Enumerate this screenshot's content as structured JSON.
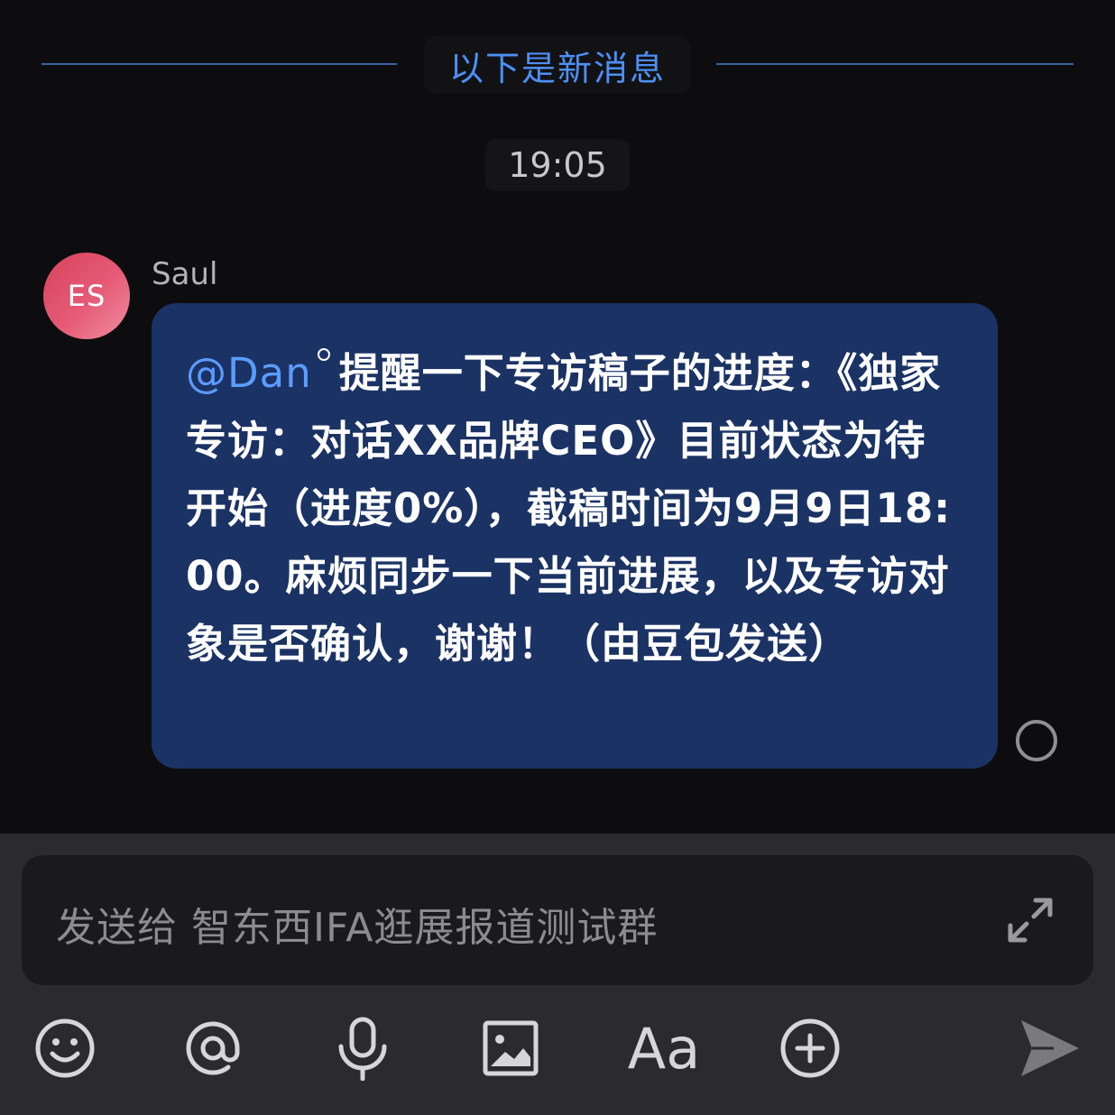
{
  "divider": {
    "label": "以下是新消息"
  },
  "timestamp": "19:05",
  "message": {
    "avatar_initials": "ES",
    "sender": "Saul",
    "mention": "@Dan",
    "text": "提醒一下专访稿子的进度：《独家专访：对话XX品牌CEO》目前状态为待开始（进度0%），截稿时间为9月9日18:00。麻烦同步一下当前进展，以及专访对象是否确认，谢谢！（由豆包发送）",
    "status_icon": "unread-circle-icon"
  },
  "composer": {
    "placeholder": "发送给 智东西IFA逛展报道测试群",
    "font_tool_label": "Aa",
    "icons": [
      "emoji-icon",
      "mention-icon",
      "microphone-icon",
      "image-icon",
      "font-format-icon",
      "add-icon",
      "send-icon"
    ]
  },
  "colors": {
    "background": "#0d0d0f",
    "bubble": "#1b3264",
    "accent": "#4e8ff5",
    "mention": "#5b9cff",
    "composer": "#2b2b2d"
  }
}
